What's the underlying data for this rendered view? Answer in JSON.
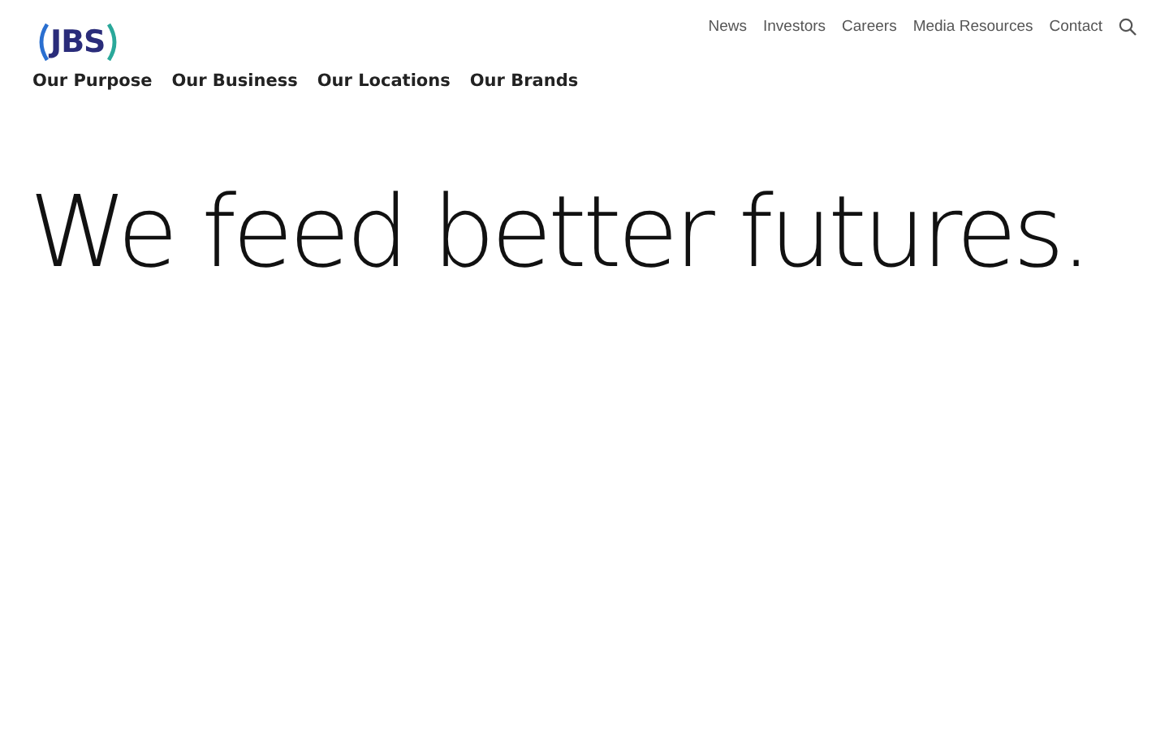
{
  "logo": {
    "text": "JBS"
  },
  "utility_nav": [
    {
      "label": "News"
    },
    {
      "label": "Investors"
    },
    {
      "label": "Careers"
    },
    {
      "label": "Media Resources"
    },
    {
      "label": "Contact"
    }
  ],
  "main_nav": [
    {
      "label": "Our Purpose"
    },
    {
      "label": "Our Business"
    },
    {
      "label": "Our Locations"
    },
    {
      "label": "Our Brands"
    }
  ],
  "hero": {
    "headline": "We feed better futures."
  }
}
